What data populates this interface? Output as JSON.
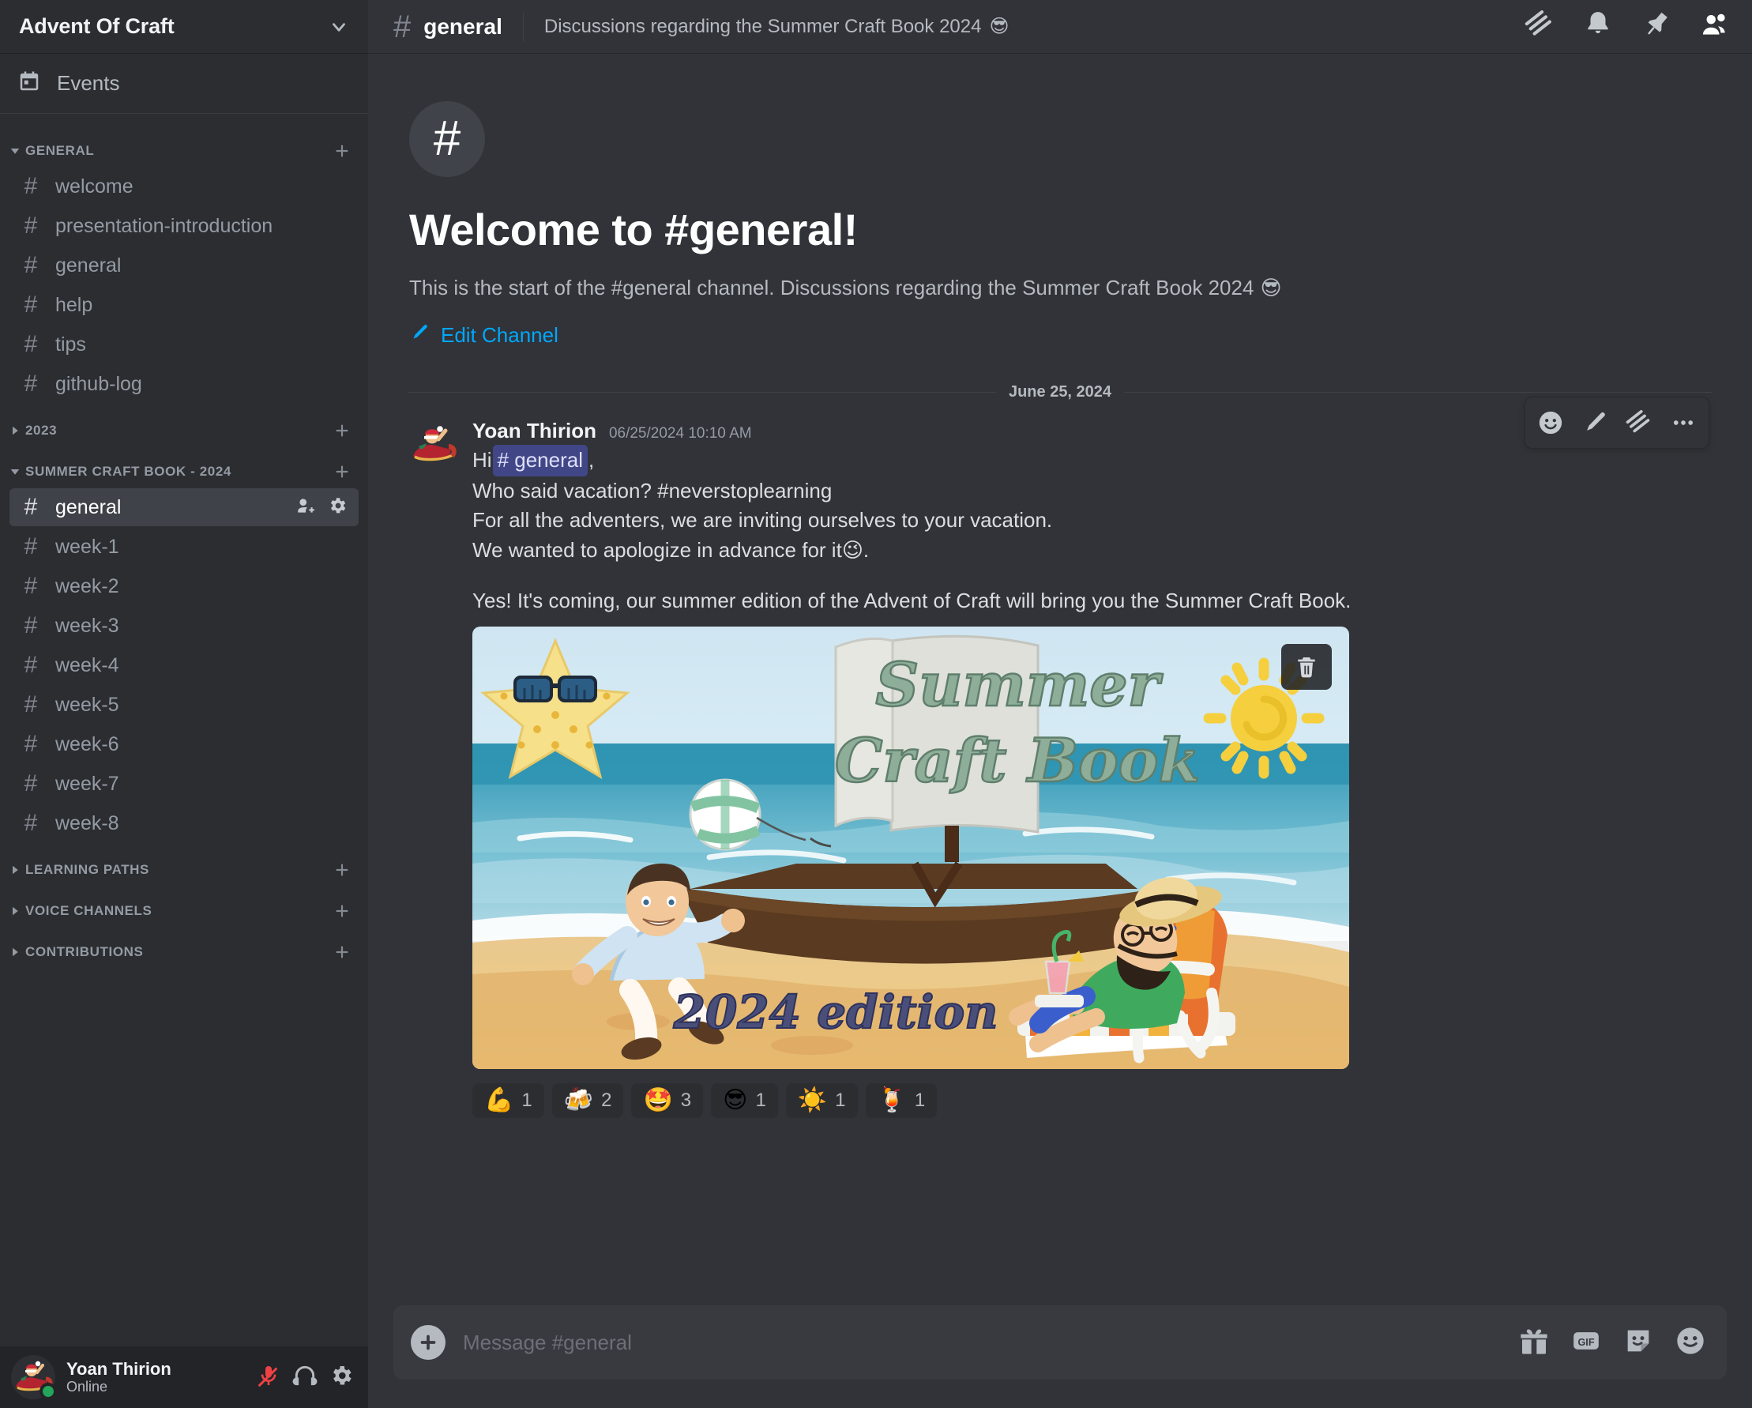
{
  "sidebar": {
    "server_name": "Advent Of Craft",
    "events_label": "Events",
    "categories": [
      {
        "name": "GENERAL",
        "expanded": true,
        "channels": [
          {
            "name": "welcome"
          },
          {
            "name": "presentation-introduction"
          },
          {
            "name": "general"
          },
          {
            "name": "help"
          },
          {
            "name": "tips"
          },
          {
            "name": "github-log"
          }
        ]
      },
      {
        "name": "2023",
        "expanded": false,
        "channels": []
      },
      {
        "name": "SUMMER CRAFT BOOK - 2024",
        "expanded": true,
        "channels": [
          {
            "name": "general",
            "active": true
          },
          {
            "name": "week-1"
          },
          {
            "name": "week-2"
          },
          {
            "name": "week-3"
          },
          {
            "name": "week-4"
          },
          {
            "name": "week-5"
          },
          {
            "name": "week-6"
          },
          {
            "name": "week-7"
          },
          {
            "name": "week-8"
          }
        ]
      },
      {
        "name": "LEARNING PATHS",
        "expanded": false,
        "channels": []
      },
      {
        "name": "VOICE CHANNELS",
        "expanded": false,
        "channels": []
      },
      {
        "name": "CONTRIBUTIONS",
        "expanded": false,
        "channels": []
      }
    ]
  },
  "user_panel": {
    "name": "Yoan Thirion",
    "status": "Online",
    "status_color": "#23a55a",
    "mic_muted": true
  },
  "topbar": {
    "channel_name": "general",
    "topic": "Discussions regarding the Summer Craft Book 2024",
    "topic_emoji": "😎"
  },
  "intro": {
    "title": "Welcome to #general!",
    "description": "This is the start of the #general channel. Discussions regarding the Summer Craft Book 2024",
    "description_emoji": "😎",
    "edit_label": "Edit Channel",
    "edit_link_color": "#00a8fc"
  },
  "divider": {
    "date": "June 25, 2024"
  },
  "message": {
    "author": "Yoan Thirion",
    "timestamp": "06/25/2024 10:10 AM",
    "line1_prefix": "Hi ",
    "mention": "general",
    "line1_suffix": ",",
    "line2": "Who said vacation? #neverstoplearning",
    "line3": "For all the adventers, we are inviting ourselves to your vacation.",
    "line4_prefix": "We wanted to apologize in advance for it ",
    "line4_emoji": "😉",
    "line4_suffix": ".",
    "line5": "Yes! It's coming, our summer edition of the Advent of Craft will bring you the Summer Craft Book.",
    "attachment": {
      "sail_line1": "Summer",
      "sail_line2": "Craft Book",
      "sand_text": "2024 edition"
    },
    "reactions": [
      {
        "emoji": "💪",
        "count": "1"
      },
      {
        "emoji": "🍻",
        "count": "2"
      },
      {
        "emoji": "🤩",
        "count": "3"
      },
      {
        "emoji": "😎",
        "count": "1"
      },
      {
        "emoji": "☀️",
        "count": "1"
      },
      {
        "emoji": "🍹",
        "count": "1"
      }
    ]
  },
  "composer": {
    "placeholder": "Message #general",
    "value": ""
  }
}
